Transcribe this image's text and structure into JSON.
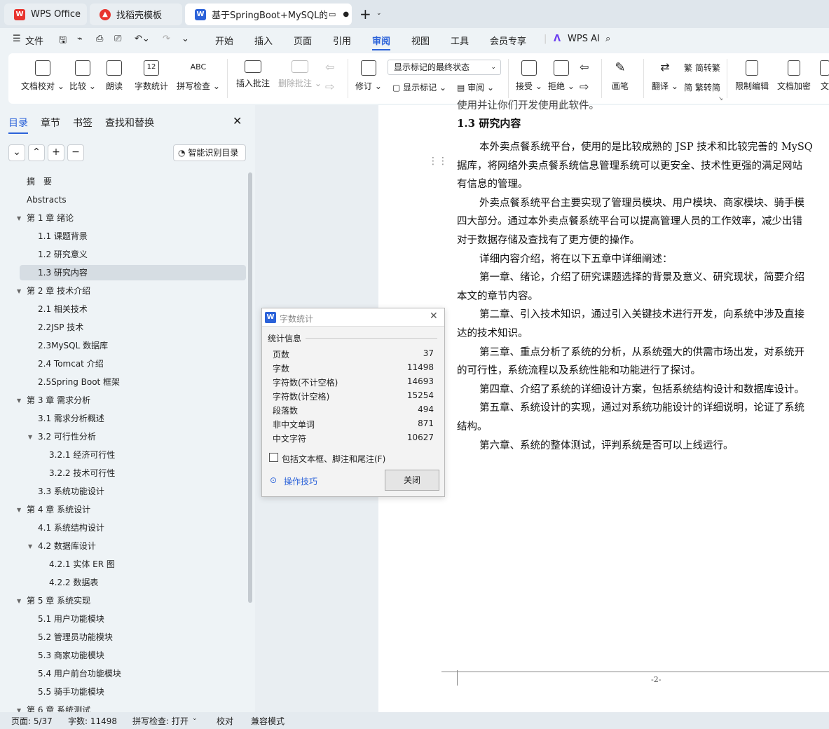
{
  "tabs": [
    {
      "label": "WPS Office",
      "icon": "wps-logo"
    },
    {
      "label": "找稻壳模板",
      "icon": "docer-logo"
    },
    {
      "label": "基于SpringBoot+MySQL的外",
      "icon": "writer-doc"
    }
  ],
  "menu": {
    "file": "文件",
    "items": [
      "开始",
      "插入",
      "页面",
      "引用",
      "审阅",
      "视图",
      "工具",
      "会员专享"
    ],
    "active": "审阅",
    "ai": "WPS AI"
  },
  "ribbon": {
    "buttons": [
      "文档校对",
      "比较",
      "朗读",
      "字数统计",
      "拼写检查",
      "插入批注",
      "删除批注",
      "修订",
      "接受",
      "拒绝",
      "画笔",
      "翻译",
      "限制编辑",
      "文档加密",
      "文"
    ],
    "tracking_mode": "显示标记的最终状态",
    "show_markup": "显示标记",
    "review": "审阅",
    "to_trad": "简转繁",
    "to_simp": "繁转简",
    "abc": "ABC",
    "num12": "12"
  },
  "nav": {
    "tabs": [
      "目录",
      "章节",
      "书签",
      "查找和替换"
    ],
    "smart_btn": "智能识别目录",
    "toc": [
      {
        "label": "摘　要",
        "level": 0
      },
      {
        "label": "Abstracts",
        "level": 0
      },
      {
        "label": "第 1 章  绪论",
        "level": 0,
        "expanded": true
      },
      {
        "label": "1.1 课题背景",
        "level": 1
      },
      {
        "label": "1.2 研究意义",
        "level": 1
      },
      {
        "label": "1.3 研究内容",
        "level": 1,
        "selected": true
      },
      {
        "label": "第 2 章  技术介绍",
        "level": 0,
        "expanded": true
      },
      {
        "label": "2.1 相关技术",
        "level": 1
      },
      {
        "label": "2.2JSP 技术",
        "level": 1
      },
      {
        "label": "2.3MySQL 数据库",
        "level": 1
      },
      {
        "label": "2.4 Tomcat 介绍",
        "level": 1
      },
      {
        "label": "2.5Spring Boot 框架",
        "level": 1
      },
      {
        "label": "第 3 章  需求分析",
        "level": 0,
        "expanded": true
      },
      {
        "label": "3.1 需求分析概述",
        "level": 1
      },
      {
        "label": "3.2 可行性分析",
        "level": 1,
        "expanded": true
      },
      {
        "label": "3.2.1 经济可行性",
        "level": 2
      },
      {
        "label": "3.2.2 技术可行性",
        "level": 2
      },
      {
        "label": "3.3 系统功能设计",
        "level": 1
      },
      {
        "label": "第 4 章  系统设计",
        "level": 0,
        "expanded": true
      },
      {
        "label": "4.1 系统结构设计",
        "level": 1
      },
      {
        "label": "4.2 数据库设计",
        "level": 1,
        "expanded": true
      },
      {
        "label": "4.2.1 实体 ER 图",
        "level": 2
      },
      {
        "label": "4.2.2 数据表",
        "level": 2
      },
      {
        "label": "第 5 章  系统实现",
        "level": 0,
        "expanded": true
      },
      {
        "label": "5.1 用户功能模块",
        "level": 1
      },
      {
        "label": "5.2 管理员功能模块",
        "level": 1
      },
      {
        "label": "5.3 商家功能模块",
        "level": 1
      },
      {
        "label": "5.4 用户前台功能模块",
        "level": 1
      },
      {
        "label": "5.5 骑手功能模块",
        "level": 1
      },
      {
        "label": "第 6 章  系统测试",
        "level": 0,
        "expanded": true
      }
    ]
  },
  "doc": {
    "top_fragment": "使用并让你们开发使用此软件。",
    "heading": "1.3 研究内容",
    "lines": [
      "本外卖点餐系统平台，使用的是比较成熟的 JSP 技术和比较完善的 MySQ",
      "据库，将网络外卖点餐系统信息管理系统可以更安全、技术性更强的满足网站",
      "有信息的管理。",
      "外卖点餐系统平台主要实现了管理员模块、用户模块、商家模块、骑手模",
      "四大部分。通过本外卖点餐系统平台可以提高管理人员的工作效率，减少出错",
      "对于数据存储及查找有了更方便的操作。",
      "详细内容介绍，将在以下五章中详细阐述：",
      "第一章、绪论，介绍了研究课题选择的背景及意义、研究现状，简要介绍",
      "本文的章节内容。",
      "第二章、引入技术知识，通过引入关键技术进行开发，向系统中涉及直接",
      "达的技术知识。",
      "第三章、重点分析了系统的分析，从系统强大的供需市场出发，对系统开",
      "的可行性，系统流程以及系统性能和功能进行了探讨。",
      "第四章、介绍了系统的详细设计方案，包括系统结构设计和数据库设计。",
      "第五章、系统设计的实现，通过对系统功能设计的详细说明，论证了系统",
      "结构。",
      "第六章、系统的整体测试，评判系统是否可以上线运行。"
    ],
    "indented": [
      true,
      false,
      false,
      true,
      false,
      false,
      true,
      true,
      false,
      true,
      false,
      true,
      false,
      true,
      true,
      false,
      true
    ],
    "page_number": "-2-"
  },
  "dialog": {
    "title": "字数统计",
    "section": "统计信息",
    "stats": [
      {
        "label": "页数",
        "value": "37"
      },
      {
        "label": "字数",
        "value": "11498"
      },
      {
        "label": "字符数(不计空格)",
        "value": "14693"
      },
      {
        "label": "字符数(计空格)",
        "value": "15254"
      },
      {
        "label": "段落数",
        "value": "494"
      },
      {
        "label": "非中文单词",
        "value": "871"
      },
      {
        "label": "中文字符",
        "value": "10627"
      }
    ],
    "checkbox": "包括文本框、脚注和尾注(F)",
    "tips": "操作技巧",
    "close": "关闭"
  },
  "status": {
    "page": "页面: 5/37",
    "words": "字数: 11498",
    "spell": "拼写检查: 打开",
    "proof": "校对",
    "compat": "兼容模式"
  },
  "colors": {
    "accent": "#2b62d9",
    "wps_red": "#e8342f",
    "selected_row": "#d6dde3"
  }
}
